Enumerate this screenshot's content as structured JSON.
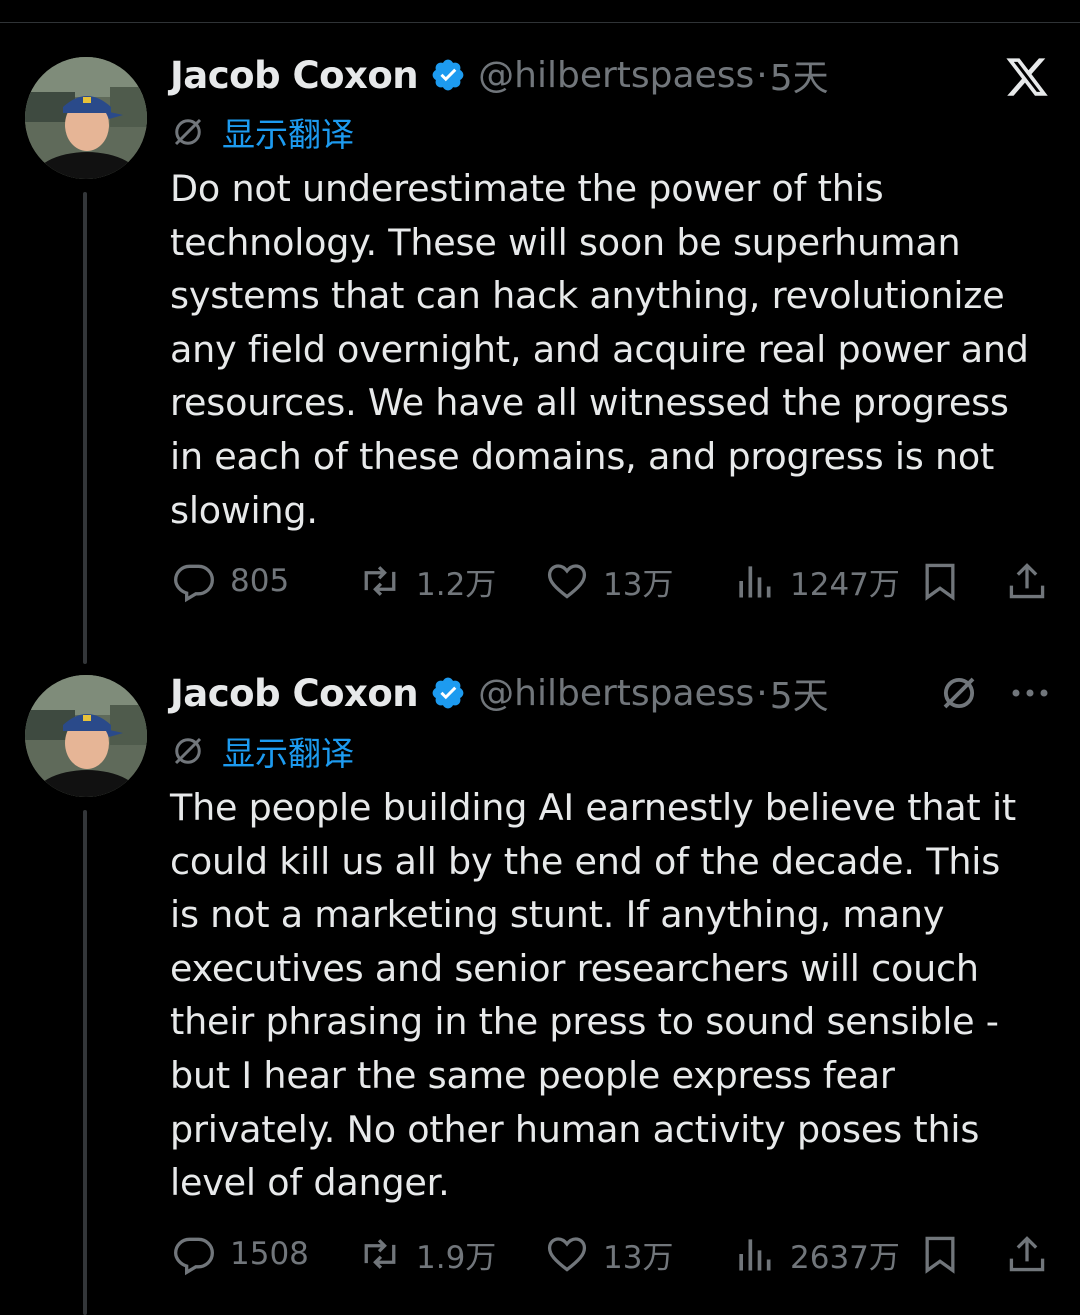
{
  "app": {
    "logo_icon": "x-logo-icon"
  },
  "tweets": [
    {
      "name": "Jacob Coxon",
      "handle": "@hilbertspaess",
      "separator": "·",
      "time": "5天",
      "verified_color": "#1d9bf0",
      "translate_label": "显示翻译",
      "text_lines": [
        "Do not underestimate the power of this",
        "technology. These will soon be superhuman",
        "systems that can hack anything, revolutionize",
        "any field overnight, and acquire real power and",
        "resources. We have all witnessed the progress",
        "in each of these domains, and progress is not",
        "slowing."
      ],
      "replies": "805",
      "reposts": "1.2万",
      "likes": "13万",
      "views": "1247万"
    },
    {
      "name": "Jacob Coxon",
      "handle": "@hilbertspaess",
      "separator": "·",
      "time": "5天",
      "verified_color": "#1d9bf0",
      "translate_label": "显示翻译",
      "text_lines": [
        "The people building AI earnestly believe that it",
        "could kill us all by the end of the decade. This",
        "is not a marketing stunt. If anything, many",
        "executives and senior researchers will couch",
        "their phrasing in the press to sound sensible -",
        "but I hear the same people express fear",
        "privately. No other human activity poses this",
        "level of danger."
      ],
      "replies": "1508",
      "reposts": "1.9万",
      "likes": "13万",
      "views": "2637万"
    }
  ]
}
